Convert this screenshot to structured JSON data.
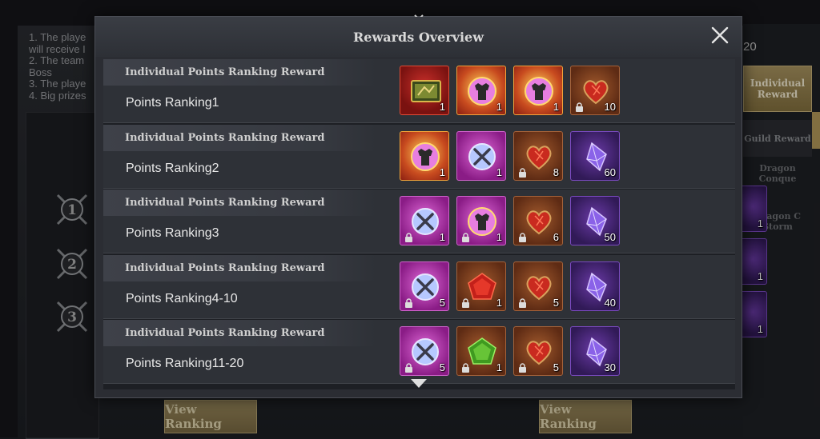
{
  "background": {
    "rules": [
      "1. The playe",
      "will receive I",
      "2. The team",
      "Boss",
      "3. The playe",
      "4. Big prizes"
    ],
    "count_text": "20",
    "tabs": {
      "individual_reward": "Individual Reward",
      "guild_reward": "Guild Reward",
      "dragon_conquest": "Dragon Conque",
      "dragon_storm": "Dragon C Storm"
    },
    "rank_badges": [
      "1",
      "2",
      "3"
    ],
    "view_ranking_left": "View Ranking",
    "view_ranking_right": "View Ranking",
    "side_item_counts": [
      "1",
      "1",
      "1"
    ]
  },
  "modal": {
    "title": "Rewards Overview",
    "rows": [
      {
        "title": "Individual Points Ranking Reward",
        "subtitle": "Points Ranking1",
        "items": [
          {
            "icon": "card-pack-icon",
            "rarity": "red",
            "qty": "1",
            "locked": false
          },
          {
            "icon": "armor-chest-icon",
            "rarity": "gold",
            "qty": "1",
            "locked": false
          },
          {
            "icon": "armor-chest-icon",
            "rarity": "gold",
            "qty": "1",
            "locked": false
          },
          {
            "icon": "dragon-heart-icon",
            "rarity": "brown",
            "qty": "10",
            "locked": true
          }
        ]
      },
      {
        "title": "Individual Points Ranking Reward",
        "subtitle": "Points Ranking2",
        "items": [
          {
            "icon": "armor-chest-icon",
            "rarity": "gold",
            "qty": "1",
            "locked": false
          },
          {
            "icon": "weapon-chest-icon",
            "rarity": "pink",
            "qty": "1",
            "locked": false
          },
          {
            "icon": "dragon-heart-icon",
            "rarity": "brown",
            "qty": "8",
            "locked": true
          },
          {
            "icon": "crystal-icon",
            "rarity": "purple",
            "qty": "60",
            "locked": false
          }
        ]
      },
      {
        "title": "Individual Points Ranking Reward",
        "subtitle": "Points Ranking3",
        "items": [
          {
            "icon": "weapon-chest-icon",
            "rarity": "pink",
            "qty": "1",
            "locked": true
          },
          {
            "icon": "armor-chest-icon",
            "rarity": "pink",
            "qty": "1",
            "locked": true
          },
          {
            "icon": "dragon-heart-icon",
            "rarity": "brown",
            "qty": "6",
            "locked": true
          },
          {
            "icon": "crystal-icon",
            "rarity": "purple",
            "qty": "50",
            "locked": false
          }
        ]
      },
      {
        "title": "Individual Points Ranking Reward",
        "subtitle": "Points Ranking4-10",
        "items": [
          {
            "icon": "weapon-chest-icon",
            "rarity": "pink",
            "qty": "5",
            "locked": true
          },
          {
            "icon": "red-gem-icon",
            "rarity": "brown",
            "qty": "1",
            "locked": true
          },
          {
            "icon": "dragon-heart-icon",
            "rarity": "brown",
            "qty": "5",
            "locked": true
          },
          {
            "icon": "crystal-icon",
            "rarity": "purple",
            "qty": "40",
            "locked": false
          }
        ]
      },
      {
        "title": "Individual Points Ranking Reward",
        "subtitle": "Points Ranking11-20",
        "items": [
          {
            "icon": "weapon-chest-icon",
            "rarity": "pink",
            "qty": "5",
            "locked": true
          },
          {
            "icon": "green-gem-icon",
            "rarity": "brown",
            "qty": "1",
            "locked": true
          },
          {
            "icon": "dragon-heart-icon",
            "rarity": "brown",
            "qty": "5",
            "locked": true
          },
          {
            "icon": "crystal-icon",
            "rarity": "purple",
            "qty": "30",
            "locked": false
          }
        ]
      }
    ]
  },
  "colors": {
    "accent_gold": "#a99460",
    "modal_bg": "#2b2d33",
    "row_bg": "#2e3137"
  }
}
